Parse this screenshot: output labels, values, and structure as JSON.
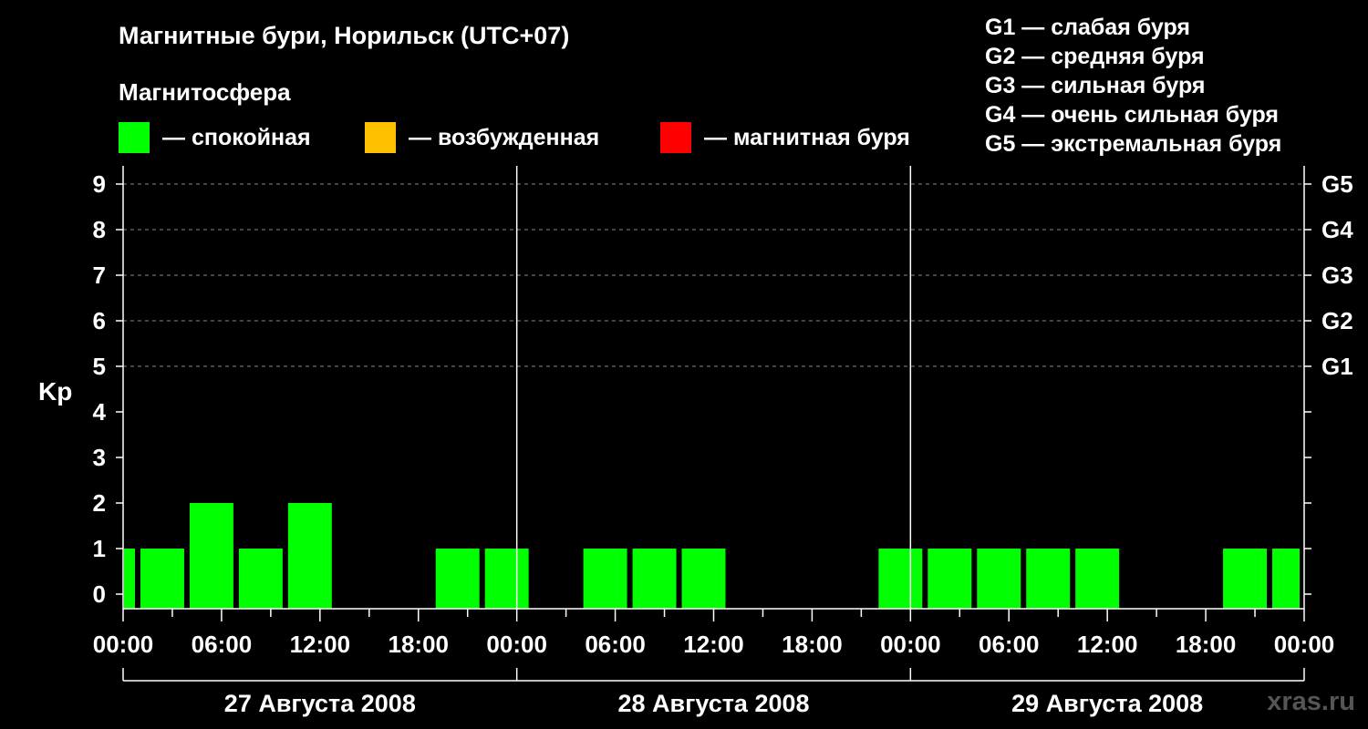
{
  "header": {
    "title": "Магнитные бури, Норильск (UTC+07)",
    "subtitle": "Магнитосфера"
  },
  "legend": {
    "items": [
      {
        "label": "— спокойная",
        "color": "#00ff00"
      },
      {
        "label": "— возбужденная",
        "color": "#ffc000"
      },
      {
        "label": "— магнитная буря",
        "color": "#ff0000"
      }
    ]
  },
  "storm_scale": [
    "G1 — слабая буря",
    "G2 — средняя буря",
    "G3 — сильная буря",
    "G4 — очень сильная буря",
    "G5 — экстремальная буря"
  ],
  "watermark": "xras.ru",
  "chart_data": {
    "type": "bar",
    "ylabel": "Kp",
    "ylim": [
      0,
      9
    ],
    "y_ticks": [
      "0",
      "1",
      "2",
      "3",
      "4",
      "5",
      "6",
      "7",
      "8",
      "9"
    ],
    "right_tick_labels": [
      {
        "y": 5,
        "label": "G1"
      },
      {
        "y": 6,
        "label": "G2"
      },
      {
        "y": 7,
        "label": "G3"
      },
      {
        "y": 8,
        "label": "G4"
      },
      {
        "y": 9,
        "label": "G5"
      }
    ],
    "x_tick_labels": [
      "00:00",
      "06:00",
      "12:00",
      "18:00",
      "00:00",
      "06:00",
      "12:00",
      "18:00",
      "00:00",
      "06:00",
      "12:00",
      "18:00",
      "00:00"
    ],
    "x_hours_range": [
      0,
      72
    ],
    "days": [
      "27 Августа 2008",
      "28 Августа 2008",
      "29 Августа 2008"
    ],
    "grid": "dashed horizontal at Kp 5-9",
    "bars": [
      {
        "start_h": 0,
        "end_h": 1,
        "kp": 1,
        "color": "#00ff00"
      },
      {
        "start_h": 1,
        "end_h": 4,
        "kp": 1,
        "color": "#00ff00"
      },
      {
        "start_h": 4,
        "end_h": 7,
        "kp": 2,
        "color": "#00ff00"
      },
      {
        "start_h": 7,
        "end_h": 10,
        "kp": 1,
        "color": "#00ff00"
      },
      {
        "start_h": 10,
        "end_h": 13,
        "kp": 2,
        "color": "#00ff00"
      },
      {
        "start_h": 19,
        "end_h": 22,
        "kp": 1,
        "color": "#00ff00"
      },
      {
        "start_h": 22,
        "end_h": 25,
        "kp": 1,
        "color": "#00ff00"
      },
      {
        "start_h": 28,
        "end_h": 31,
        "kp": 1,
        "color": "#00ff00"
      },
      {
        "start_h": 31,
        "end_h": 34,
        "kp": 1,
        "color": "#00ff00"
      },
      {
        "start_h": 34,
        "end_h": 37,
        "kp": 1,
        "color": "#00ff00"
      },
      {
        "start_h": 46,
        "end_h": 49,
        "kp": 1,
        "color": "#00ff00"
      },
      {
        "start_h": 49,
        "end_h": 52,
        "kp": 1,
        "color": "#00ff00"
      },
      {
        "start_h": 52,
        "end_h": 55,
        "kp": 1,
        "color": "#00ff00"
      },
      {
        "start_h": 55,
        "end_h": 58,
        "kp": 1,
        "color": "#00ff00"
      },
      {
        "start_h": 58,
        "end_h": 61,
        "kp": 1,
        "color": "#00ff00"
      },
      {
        "start_h": 67,
        "end_h": 70,
        "kp": 1,
        "color": "#00ff00"
      },
      {
        "start_h": 70,
        "end_h": 72,
        "kp": 1,
        "color": "#00ff00"
      }
    ]
  }
}
